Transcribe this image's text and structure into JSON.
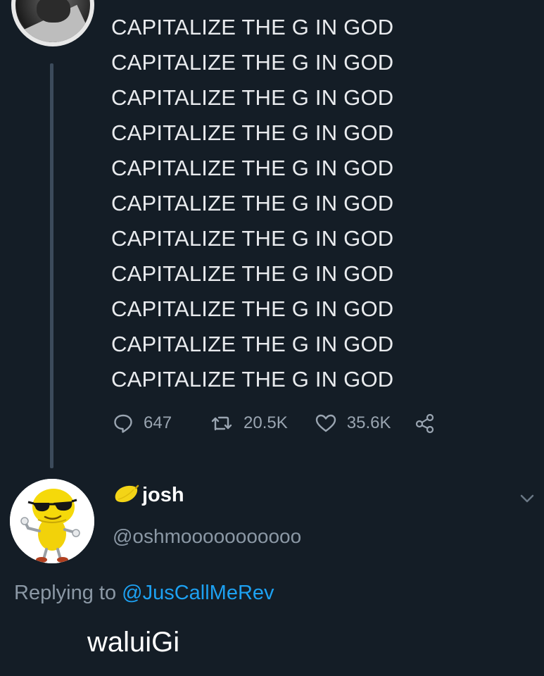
{
  "tweet": {
    "lines": [
      "CAPITALIZE THE G IN GOD",
      "CAPITALIZE THE G IN GOD",
      "CAPITALIZE THE G IN GOD",
      "CAPITALIZE THE G IN GOD",
      "CAPITALIZE THE G IN GOD",
      "CAPITALIZE THE G IN GOD",
      "CAPITALIZE THE G IN GOD",
      "CAPITALIZE THE G IN GOD",
      "CAPITALIZE THE G IN GOD",
      "CAPITALIZE THE G IN GOD",
      "CAPITALIZE THE G IN GOD"
    ],
    "replies_count": "647",
    "retweets_count": "20.5K",
    "likes_count": "35.6K",
    "icons": {
      "reply": "reply-bubble-icon",
      "retweet": "retweet-icon",
      "like": "heart-icon",
      "share": "share-icon"
    }
  },
  "reply": {
    "display_name": "josh",
    "name_emoji": "lemon-emoji",
    "handle": "@oshmooooooooooo",
    "replying_prefix": "Replying to",
    "replying_to": "@JusCallMeRev",
    "text": "waluiGi"
  },
  "colors": {
    "background": "#141d26",
    "text": "#e9ebee",
    "muted": "#8b98a5",
    "link": "#1da1f2",
    "thread_line": "#3c4b5b"
  }
}
